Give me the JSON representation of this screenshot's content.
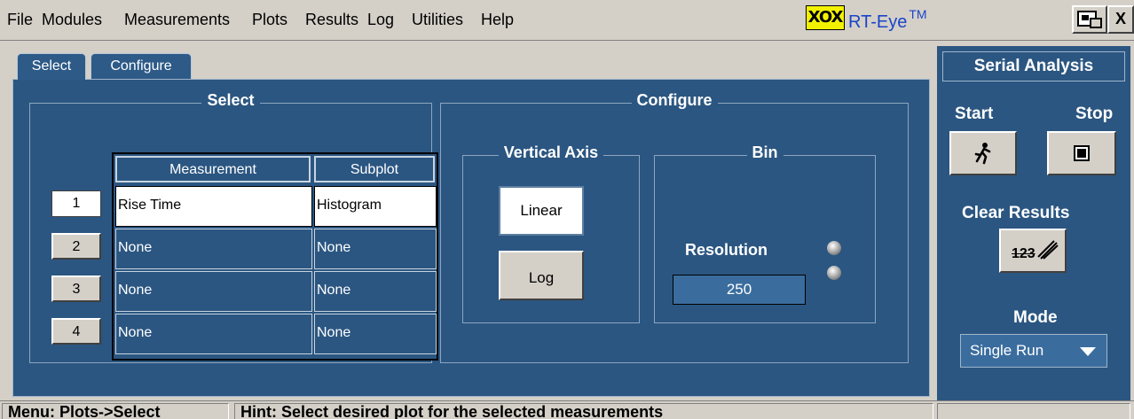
{
  "menu": {
    "items": [
      "File",
      "Modules",
      "Measurements",
      "Plots",
      "Results",
      "Log",
      "Utilities",
      "Help"
    ]
  },
  "brand": {
    "logo_text": "XOX",
    "name": "RT-Eye",
    "trademark": "TM"
  },
  "window_buttons": {
    "minimize_icon": "minimize-window-icon",
    "close_label": "X"
  },
  "tabs": [
    {
      "label": "Select",
      "active": true
    },
    {
      "label": "Configure",
      "active": false
    }
  ],
  "select_panel": {
    "title": "Select",
    "table": {
      "headers": [
        "Measurement",
        "Subplot"
      ],
      "rows": [
        {
          "num": "1",
          "measurement": "Rise Time",
          "subplot": "Histogram",
          "selected": true
        },
        {
          "num": "2",
          "measurement": "None",
          "subplot": "None",
          "selected": false
        },
        {
          "num": "3",
          "measurement": "None",
          "subplot": "None",
          "selected": false
        },
        {
          "num": "4",
          "measurement": "None",
          "subplot": "None",
          "selected": false
        }
      ]
    }
  },
  "configure_panel": {
    "title": "Configure",
    "vertical_axis": {
      "title": "Vertical Axis",
      "options": [
        "Linear",
        "Log"
      ],
      "selected": "Linear"
    },
    "bin": {
      "title": "Bin",
      "resolution_label": "Resolution",
      "resolution_value": "250"
    }
  },
  "right_panel": {
    "title": "Serial Analysis",
    "start_label": "Start",
    "stop_label": "Stop",
    "start_icon": "running-man-icon",
    "stop_icon": "stop-square-icon",
    "clear_label": "Clear Results",
    "clear_icon_text": "123",
    "mode_label": "Mode",
    "mode_value": "Single Run"
  },
  "status_bar": {
    "menu_path": "Menu: Plots->Select",
    "hint": "Hint: Select desired plot for the selected measurements",
    "extra": ""
  },
  "colors": {
    "panel_blue": "#2b5681",
    "field_blue": "#3a6d9e",
    "chrome_gray": "#d4d0c8",
    "brand_blue": "#1a44c8",
    "logo_yellow": "#f2f200"
  }
}
